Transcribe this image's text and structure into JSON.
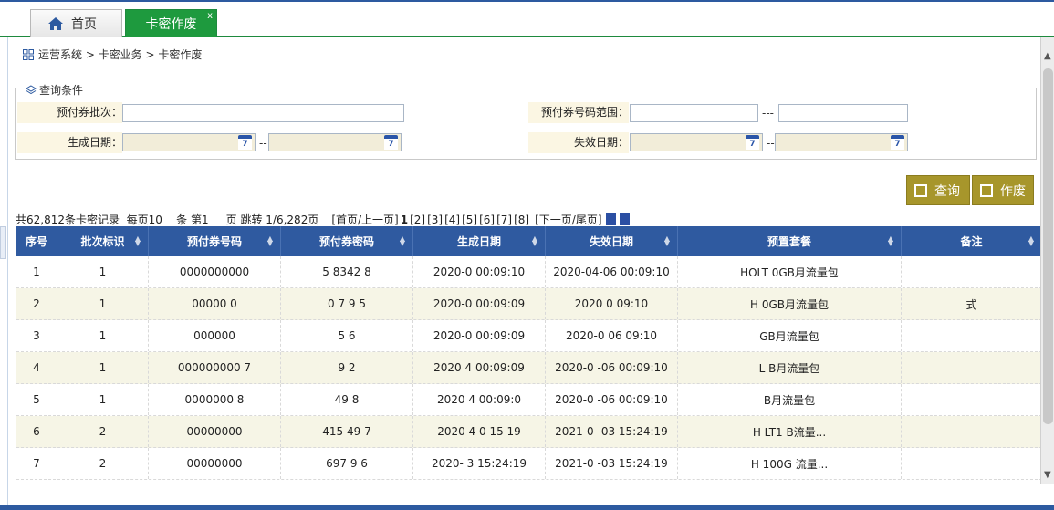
{
  "tabs": {
    "home_label": "首页",
    "active_label": "卡密作废",
    "close_glyph": "x"
  },
  "breadcrumb": "运营系统 > 卡密业务 > 卡密作废",
  "query": {
    "legend": "查询条件",
    "batch_label": "预付券批次：",
    "range_label": "预付券号码范围：",
    "range_sep": "---",
    "created_label": "生成日期：",
    "expire_label": "失效日期：",
    "date_sep": "--"
  },
  "buttons": {
    "query_label": "查询",
    "void_label": "作废"
  },
  "pager": {
    "summary": "共62,812条卡密记录  每页10    条 第1     页 跳转 1/6,282页",
    "first_prev": "[首页/上一页]",
    "pages": [
      "1",
      "[2]",
      "[3]",
      "[4]",
      "[5]",
      "[6]",
      "[7]",
      "[8]"
    ],
    "next_last": "[下一页/尾页]"
  },
  "table": {
    "columns": [
      "序号",
      "批次标识",
      "预付券号码",
      "预付券密码",
      "生成日期",
      "失效日期",
      "预置套餐",
      "备注"
    ],
    "rows": [
      [
        "1",
        "1",
        "0000000000",
        "5 8342 8",
        "2020-0 00:09:10",
        "2020-04-06 00:09:10",
        "HOLT 0GB月流量包",
        ""
      ],
      [
        "2",
        "1",
        "00000 0",
        "0 7 9 5",
        "2020-0 00:09:09",
        "2020 0 09:10",
        "H 0GB月流量包",
        "式"
      ],
      [
        "3",
        "1",
        "000000",
        "5 6",
        "2020-0 00:09:09",
        "2020-0 06 09:10",
        "GB月流量包",
        ""
      ],
      [
        "4",
        "1",
        "000000000 7",
        "9 2",
        "2020 4 00:09:09",
        "2020-0 -06 00:09:10",
        "L B月流量包",
        ""
      ],
      [
        "5",
        "1",
        "0000000 8",
        "49 8",
        "2020 4 00:09:0",
        "2020-0 -06 00:09:10",
        "B月流量包",
        ""
      ],
      [
        "6",
        "2",
        "00000000",
        "415 49 7",
        "2020 4 0 15 19",
        "2021-0 -03 15:24:19",
        "H LT1 B流量...",
        ""
      ],
      [
        "7",
        "2",
        "00000000",
        "697 9 6",
        "2020- 3 15:24:19",
        "2021-0 -03 15:24:19",
        "H 100G 流量...",
        ""
      ]
    ]
  }
}
